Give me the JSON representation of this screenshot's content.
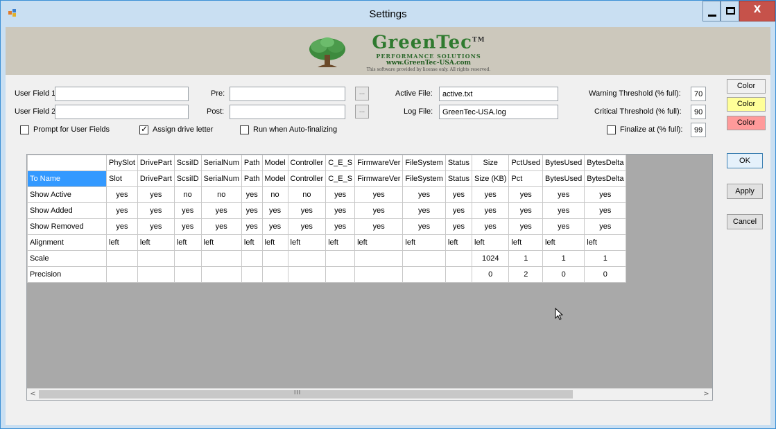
{
  "window": {
    "title": "Settings",
    "minimize": "_",
    "close": "X"
  },
  "banner": {
    "brand": "GreenTec",
    "tm": "TM",
    "tagline": "PERFORMANCE SOLUTIONS",
    "url": "www.GreenTec-USA.com",
    "notice": "This software provided by license only.    All rights reserved."
  },
  "fields": {
    "user_field_1": {
      "label": "User Field 1:",
      "value": ""
    },
    "user_field_2": {
      "label": "User Field 2:",
      "value": ""
    },
    "pre": {
      "label": "Pre:",
      "value": "",
      "browse": "..."
    },
    "post": {
      "label": "Post:",
      "value": "",
      "browse": "..."
    },
    "active_file": {
      "label": "Active File:",
      "value": "active.txt"
    },
    "log_file": {
      "label": "Log File:",
      "value": "GreenTec-USA.log"
    },
    "warning_threshold": {
      "label": "Warning Threshold (% full):",
      "value": "70"
    },
    "critical_threshold": {
      "label": "Critical Threshold (% full):",
      "value": "90"
    },
    "finalize_at": {
      "label": "Finalize at (% full):",
      "value": "99",
      "checked": false
    }
  },
  "checkboxes": {
    "prompt_user_fields": {
      "label": "Prompt for User Fields",
      "checked": false
    },
    "assign_drive_letter": {
      "label": "Assign drive letter",
      "checked": true
    },
    "run_auto_finalizing": {
      "label": "Run when Auto-finalizing",
      "checked": false
    }
  },
  "color_buttons": [
    {
      "label": "Color",
      "bg": "#f0f0f0"
    },
    {
      "label": "Color",
      "bg": "#ffff99"
    },
    {
      "label": "Color",
      "bg": "#ff9a9a"
    }
  ],
  "buttons": {
    "ok": "OK",
    "apply": "Apply",
    "cancel": "Cancel"
  },
  "grid": {
    "columns": [
      "PhySlot",
      "DrivePart",
      "ScsiID",
      "SerialNum",
      "Path",
      "Model",
      "Controller",
      "C_E_S",
      "FirmwareVer",
      "FileSystem",
      "Status",
      "Size",
      "PctUsed",
      "BytesUsed",
      "BytesDelta"
    ],
    "rows": [
      {
        "name": "To Name",
        "selected": true,
        "align": "l",
        "cells": [
          "Slot",
          "DrivePart",
          "ScsiID",
          "SerialNum",
          "Path",
          "Model",
          "Controller",
          "C_E_S",
          "FirmwareVer",
          "FileSystem",
          "Status",
          "Size (KB)",
          "Pct",
          "BytesUsed",
          "BytesDelta"
        ]
      },
      {
        "name": "Show Active",
        "align": "c",
        "cells": [
          "yes",
          "yes",
          "no",
          "no",
          "yes",
          "no",
          "no",
          "yes",
          "yes",
          "yes",
          "yes",
          "yes",
          "yes",
          "yes",
          "yes"
        ]
      },
      {
        "name": "Show Added",
        "align": "c",
        "cells": [
          "yes",
          "yes",
          "yes",
          "yes",
          "yes",
          "yes",
          "yes",
          "yes",
          "yes",
          "yes",
          "yes",
          "yes",
          "yes",
          "yes",
          "yes"
        ]
      },
      {
        "name": "Show Removed",
        "align": "c",
        "cells": [
          "yes",
          "yes",
          "yes",
          "yes",
          "yes",
          "yes",
          "yes",
          "yes",
          "yes",
          "yes",
          "yes",
          "yes",
          "yes",
          "yes",
          "yes"
        ]
      },
      {
        "name": "Alignment",
        "align": "l",
        "cells": [
          "left",
          "left",
          "left",
          "left",
          "left",
          "left",
          "left",
          "left",
          "left",
          "left",
          "left",
          "left",
          "left",
          "left",
          "left"
        ]
      },
      {
        "name": "Scale",
        "align": "c",
        "cells": [
          "",
          "",
          "",
          "",
          "",
          "",
          "",
          "",
          "",
          "",
          "",
          "1024",
          "1",
          "1",
          "1"
        ]
      },
      {
        "name": "Precision",
        "align": "c",
        "cells": [
          "",
          "",
          "",
          "",
          "",
          "",
          "",
          "",
          "",
          "",
          "",
          "0",
          "2",
          "0",
          "0"
        ]
      }
    ],
    "scroll_left": "<",
    "scroll_right": ">",
    "scroll_grip": "III"
  }
}
